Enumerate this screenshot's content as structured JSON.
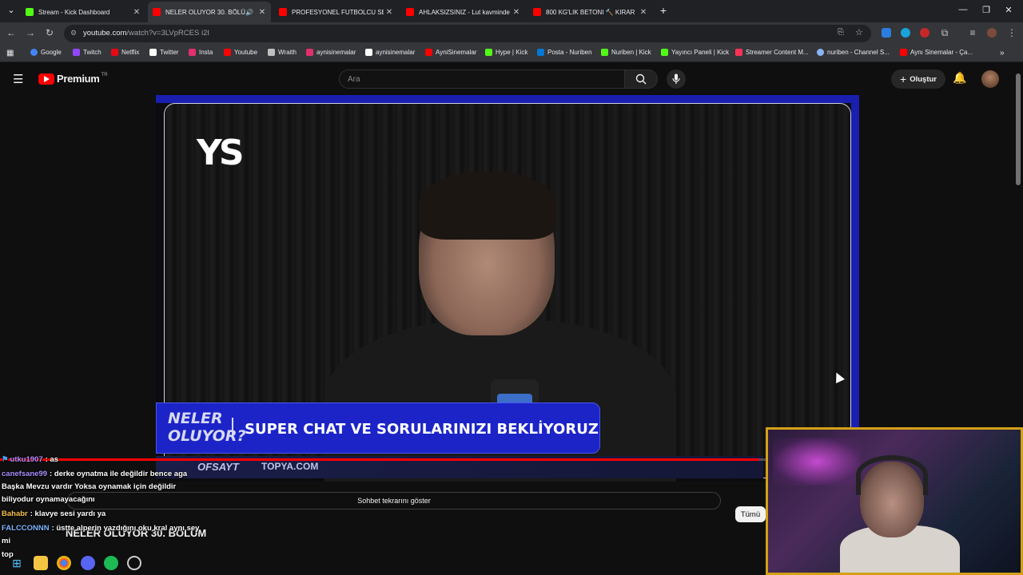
{
  "browser": {
    "tabs": [
      {
        "title": "Stream - Kick Dashboard",
        "color": "#53fc18",
        "active": false
      },
      {
        "title": "NELER OLUYOR 30. BÖLÜM",
        "color": "#ff0000",
        "active": true,
        "audio": true
      },
      {
        "title": "PROFESYONEL FUTBOLCU SEN",
        "color": "#ff0000",
        "active": false
      },
      {
        "title": "AHLAKSIZSINIZ - Lut kavminde",
        "color": "#ff0000",
        "active": false
      },
      {
        "title": "800 KG'LIK BETONI 🔨 KIRAR",
        "color": "#ff0000",
        "active": false
      }
    ],
    "new_tab": "+",
    "url_host": "youtube.com",
    "url_path": "/watch?v=3LVpRCES i2I",
    "bookmarks": [
      {
        "label": "Google",
        "color": "#4285f4"
      },
      {
        "label": "Twitch",
        "color": "#9146ff"
      },
      {
        "label": "Netflix",
        "color": "#e50914"
      },
      {
        "label": "Twitter",
        "color": "#ffffff"
      },
      {
        "label": "Insta",
        "color": "#e1306c"
      },
      {
        "label": "Youtube",
        "color": "#ff0000"
      },
      {
        "label": "Wraith",
        "color": "#c0c0c0"
      },
      {
        "label": "aynisinemalar",
        "color": "#e1306c"
      },
      {
        "label": "aynisinemalar",
        "color": "#ffffff"
      },
      {
        "label": "AyniSinemalar",
        "color": "#ff0000"
      },
      {
        "label": "Hype | Kick",
        "color": "#53fc18"
      },
      {
        "label": "Posta - Nuriben",
        "color": "#0078d4"
      },
      {
        "label": "Nuriben | Kick",
        "color": "#53fc18"
      },
      {
        "label": "Yayıncı Paneli | Kick",
        "color": "#53fc18"
      },
      {
        "label": "Streamer Content M...",
        "color": "#ff3355"
      },
      {
        "label": "nuriben - Channel S...",
        "color": "#8ab4f8"
      },
      {
        "label": "Aynı Sinemalar - Ça...",
        "color": "#ff0000"
      }
    ]
  },
  "youtube": {
    "logo_text": "Premium",
    "logo_region": "TR",
    "search_placeholder": "Ara",
    "create_label": "Oluştur",
    "chat_replay_label": "Sohbet tekrarını göster",
    "all_chip": "Tümü",
    "video_title": "NELER OLUYOR 30. BÖLÜM",
    "progress": 0.99
  },
  "video": {
    "logo": "YS",
    "lower_third_show": "NELER\nOLUYOR?",
    "lower_third_message": "SUPER CHAT VE SORULARINIZI BEKLİYORUZ",
    "sponsor_1": "OFSAYT",
    "sponsor_2": "TOPYA.COM"
  },
  "stream_chat": [
    {
      "user": "utku1907",
      "user_color": "#b58cff",
      "text": ": as"
    },
    {
      "user": "canefsane99",
      "user_color": "#a98cff",
      "text": ": derke oynatma ile değildir bence aga"
    },
    {
      "user": "",
      "user_color": "#ffffff",
      "text": "Başka Mevzu vardır Yoksa oynamak için değildir"
    },
    {
      "user": "",
      "user_color": "#ffffff",
      "text": "biliyodur oynamayacağını"
    },
    {
      "user": "Bahabr",
      "user_color": "#f5c04a",
      "text": ": klavye sesi yardı ya"
    },
    {
      "user": "FALCCONNN",
      "user_color": "#7fb3ff",
      "text": ": üstte alperin yazdığını oku kral aynı sey"
    },
    {
      "user": "",
      "user_color": "#ffffff",
      "text": "mi"
    },
    {
      "user": "",
      "user_color": "#ffffff",
      "text": "top"
    }
  ],
  "colors": {
    "accent_red": "#ff0000",
    "webcam_border": "#d4a017",
    "lower_third_blue": "#1c24c8"
  }
}
